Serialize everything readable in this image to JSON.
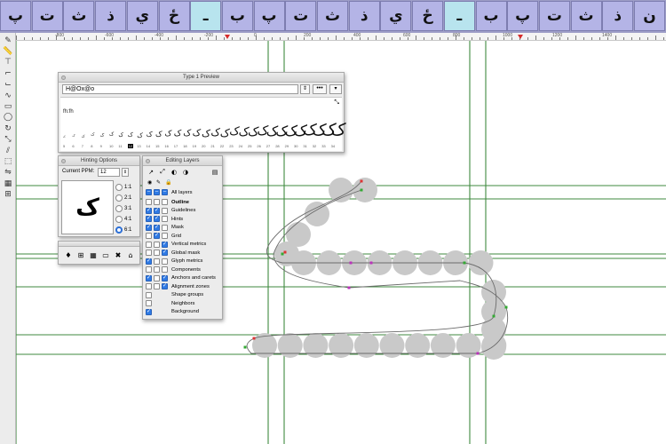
{
  "glyph_strip": {
    "cells": [
      "پ",
      "ت",
      "ث",
      "ذ",
      "ي",
      "ځ",
      "ـ",
      "ب",
      "پ",
      "ت",
      "ث",
      "ذ",
      "ي",
      "ځ",
      "ـ",
      "ب",
      "پ",
      "ت",
      "ث",
      "ذ",
      "ن"
    ],
    "selected_index": 6,
    "selected_index_2": 14
  },
  "ruler": {
    "labels": [
      "-800",
      "-600",
      "-400",
      "-200",
      "0",
      "200",
      "400",
      "600",
      "800",
      "1000",
      "1200",
      "1400"
    ]
  },
  "toolbar": {
    "tools": [
      "pencil",
      "ruler-pen",
      "thumbtack",
      "knife-left",
      "knife-right",
      "curve",
      "rectangle-tool",
      "ellipse-tool",
      "rotate",
      "scale",
      "slant",
      "perspective",
      "flip",
      "hint-grid",
      "measure"
    ]
  },
  "preview_panel": {
    "title": "Type 1 Preview",
    "text_value": "H@Ox@o",
    "stepper_glyph": "⇕",
    "more_label": "•••",
    "menu_glyph": "▾",
    "expand_glyph": "⤡",
    "small_sample": "fh:fh",
    "sizes": [
      "5",
      "6",
      "7",
      "8",
      "9",
      "10",
      "11",
      "12",
      "13",
      "14",
      "15",
      "16",
      "17",
      "18",
      "19",
      "20",
      "21",
      "22",
      "23",
      "24",
      "25",
      "26",
      "27",
      "28",
      "29",
      "30",
      "31",
      "32",
      "33",
      "34"
    ],
    "current_size": "12",
    "sample_glyph": "ک"
  },
  "hinting_panel": {
    "title": "Hinting Options",
    "ppm_label": "Current PPM:",
    "ppm_value": "12",
    "stepper_glyph": "⇕",
    "preview_glyph": "ک",
    "ratios": [
      "1:1",
      "2:1",
      "3:1",
      "4:1",
      "6:1"
    ],
    "selected_ratio": "6:1"
  },
  "tool_panel": {
    "icons": [
      "♦",
      "⊞",
      "▦",
      "▭",
      "✖",
      "⌂"
    ]
  },
  "layers_panel": {
    "title": "Editing Layers",
    "tool_glyphs": [
      "↗",
      "⤢",
      "◐",
      "◑"
    ],
    "add_glyph": "▤",
    "header_glyphs": [
      "◉",
      "✎",
      "🔒"
    ],
    "all_layers_label": "All layers",
    "rows": [
      {
        "label": "Outline",
        "bold": true,
        "c1": false,
        "c2": false,
        "c3": false
      },
      {
        "label": "Guidelines",
        "c1": true,
        "c2": true,
        "c3": false
      },
      {
        "label": "Hints",
        "c1": true,
        "c2": true,
        "c3": false
      },
      {
        "label": "Mask",
        "c1": true,
        "c2": true,
        "c3": false
      },
      {
        "label": "Grid",
        "c1": false,
        "c2": true,
        "c3": false
      },
      {
        "label": "Vertical metrics",
        "c1": false,
        "c2": false,
        "c3": true
      },
      {
        "label": "Global mask",
        "c1": false,
        "c2": false,
        "c3": true
      },
      {
        "label": "Glyph metrics",
        "c1": true,
        "c2": false,
        "c3": false
      },
      {
        "label": "Components",
        "c1": false,
        "c2": false,
        "c3": false
      },
      {
        "label": "Anchors and carets",
        "c1": true,
        "c2": false,
        "c3": true
      },
      {
        "label": "Alignment zones",
        "c1": false,
        "c2": false,
        "c3": true
      },
      {
        "label": "Shape groups",
        "c1": false,
        "c2": null,
        "c3": null
      },
      {
        "label": "Neighbors",
        "c1": false,
        "c2": null,
        "c3": null
      },
      {
        "label": "Background",
        "c1": true,
        "c2": null,
        "c3": null
      }
    ]
  },
  "colors": {
    "guide_green": "#3f8a3f",
    "hint_circle": "#c9c9c9",
    "glyph_cell": "#b4b4e6",
    "glyph_selected": "#b8e4ee",
    "checkbox_on": "#2f7ae5"
  }
}
